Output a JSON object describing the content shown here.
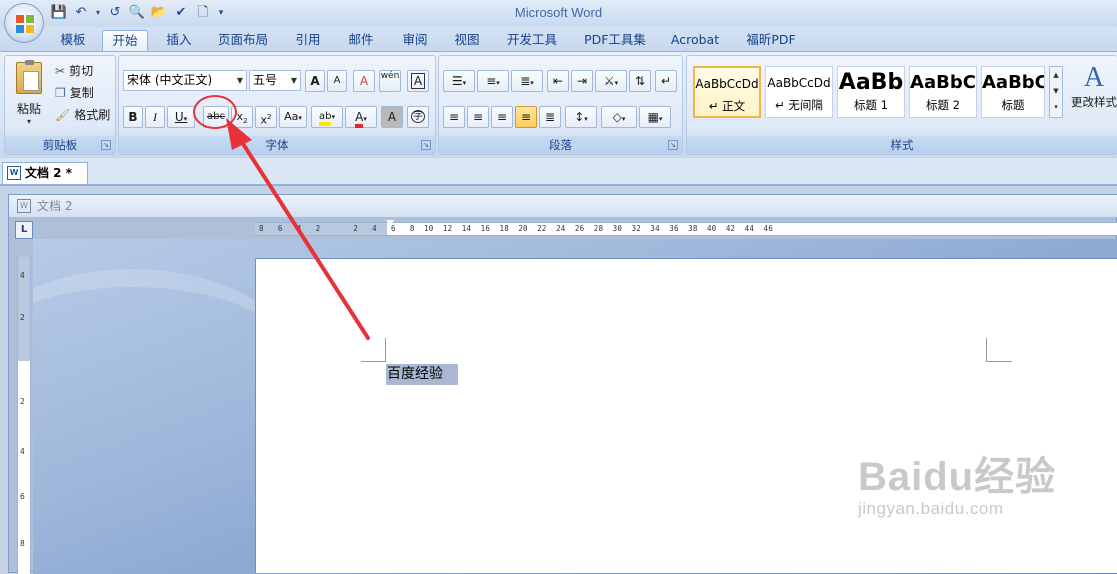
{
  "app_title": "Microsoft Word",
  "quick_access": [
    "save-icon",
    "undo-icon",
    "redo-icon",
    "print-preview-icon",
    "open-icon",
    "spelling-icon",
    "new-icon",
    "customize-icon"
  ],
  "tabs": [
    {
      "label": "模板"
    },
    {
      "label": "开始",
      "active": true
    },
    {
      "label": "插入"
    },
    {
      "label": "页面布局"
    },
    {
      "label": "引用"
    },
    {
      "label": "邮件"
    },
    {
      "label": "审阅"
    },
    {
      "label": "视图"
    },
    {
      "label": "开发工具"
    },
    {
      "label": "PDF工具集"
    },
    {
      "label": "Acrobat"
    },
    {
      "label": "福昕PDF"
    }
  ],
  "clipboard": {
    "paste": "粘贴",
    "cut": "剪切",
    "copy": "复制",
    "format_painter": "格式刷",
    "group": "剪贴板"
  },
  "font": {
    "name": "宋体 (中文正文)",
    "size": "五号",
    "group": "字体",
    "grow": "A",
    "shrink": "A",
    "clear": "A",
    "phonetic": "wén",
    "border_char": "A",
    "bold": "B",
    "italic": "I",
    "underline": "U",
    "strike": "abc",
    "sub": "x",
    "sup": "x",
    "case": "Aa",
    "highlight": "ab",
    "color": "A",
    "shading": "A",
    "encircle": "字"
  },
  "paragraph": {
    "group": "段落"
  },
  "styles": {
    "group": "样式",
    "change": "更改样式",
    "items": [
      {
        "sample": "AaBbCcDd",
        "name": "↵ 正文",
        "selected": true
      },
      {
        "sample": "AaBbCcDd",
        "name": "↵ 无间隔"
      },
      {
        "sample": "AaBb",
        "name": "标题 1"
      },
      {
        "sample": "AaBbC",
        "name": "标题 2"
      },
      {
        "sample": "AaBbC",
        "name": "标题"
      }
    ]
  },
  "doc_tab": "文档 2 *",
  "doc_window_title": "文档 2",
  "ruler_corner": "L",
  "hruler_labels": "8   6   4   2       2   4   6   8  10  12  14  16  18  20  22  24  26  28  30  32  34  36  38  40  42  44  46",
  "vruler_labels": [
    "4",
    "2",
    "2",
    "4",
    "6",
    "8"
  ],
  "document_text": "百度经验",
  "watermark": {
    "brand": "Baidu经验",
    "url": "jingyan.baidu.com"
  },
  "annotation_color": "#e8323a"
}
